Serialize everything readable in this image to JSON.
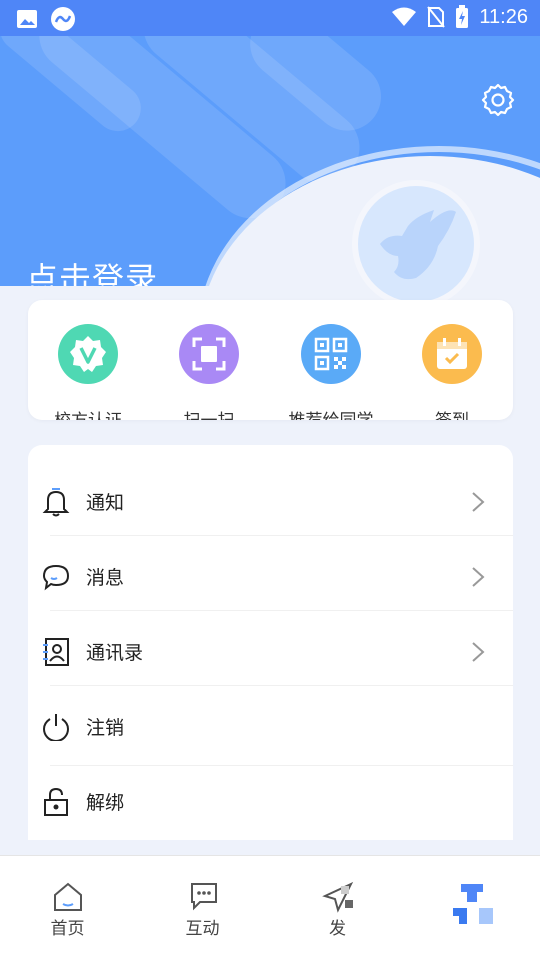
{
  "status_bar": {
    "time": "11:26"
  },
  "header": {
    "login_text": "点击登录",
    "bg_color": "#5c9dfb"
  },
  "quick_actions": [
    {
      "label": "校方认证",
      "icon": "verified-v-icon",
      "color": "#4fd8b3"
    },
    {
      "label": "扫一扫",
      "icon": "scan-icon",
      "color": "#a989f5"
    },
    {
      "label": "推荐给同学",
      "icon": "qrcode-icon",
      "color": "#5aaaf7"
    },
    {
      "label": "签到",
      "icon": "calendar-check-icon",
      "color": "#fbbb4e"
    }
  ],
  "menu": [
    {
      "label": "通知",
      "icon": "bell-icon",
      "chevron": true
    },
    {
      "label": "消息",
      "icon": "chat-bubble-icon",
      "chevron": true
    },
    {
      "label": "通讯录",
      "icon": "contacts-icon",
      "chevron": true
    },
    {
      "label": "注销",
      "icon": "power-icon",
      "chevron": false
    },
    {
      "label": "解绑",
      "icon": "unlock-icon",
      "chevron": false
    }
  ],
  "tabbar": [
    {
      "label": "首页",
      "icon": "home-icon"
    },
    {
      "label": "互动",
      "icon": "chat-icon"
    },
    {
      "label": "发",
      "icon": "send-icon"
    },
    {
      "label": "",
      "icon": "mine-icon",
      "active": true
    }
  ]
}
